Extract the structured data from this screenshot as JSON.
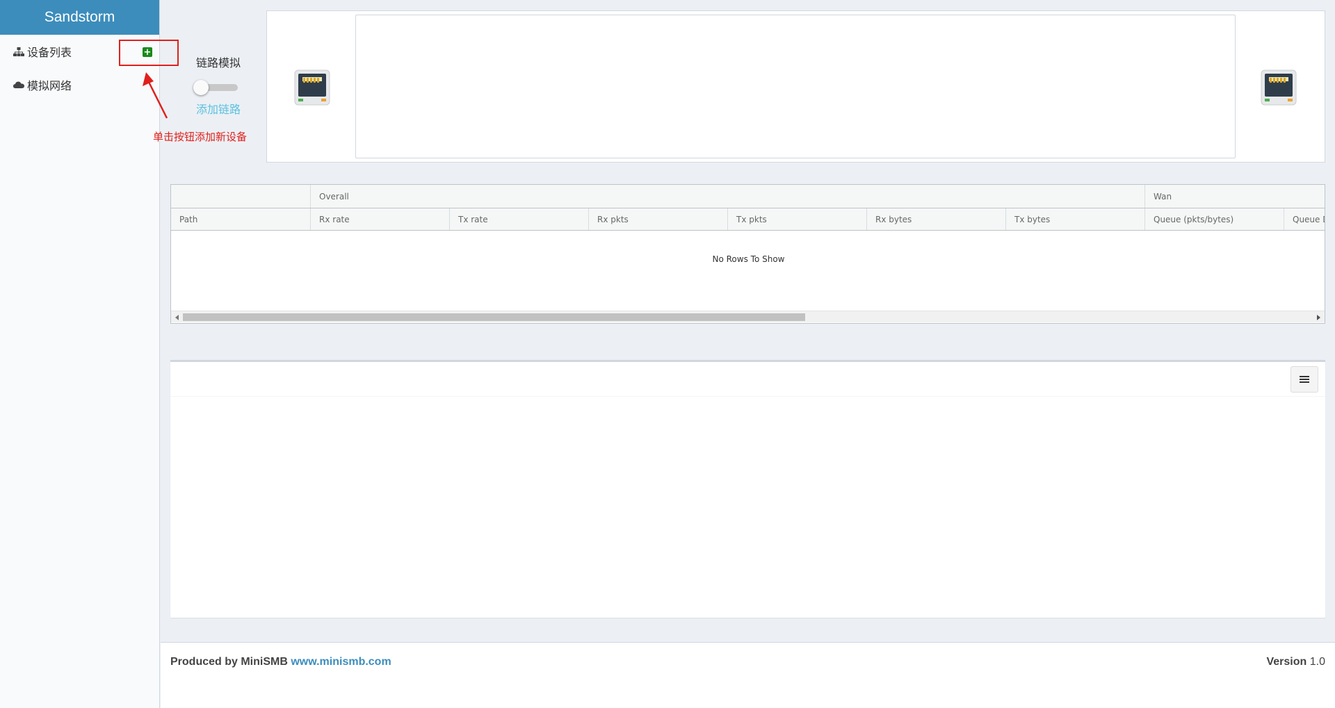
{
  "app": {
    "brand": "Sandstorm",
    "brand_color": "#3c8dbc"
  },
  "sidebar": {
    "items": [
      {
        "label": "设备列表",
        "icon": "sitemap-icon"
      },
      {
        "label": "模拟网络",
        "icon": "cloud-icon"
      }
    ],
    "add_button_icon": "plus-square-icon"
  },
  "annotation": {
    "text": "单击按钮添加新设备",
    "color": "#e0201c"
  },
  "link_sim": {
    "title": "链路模拟",
    "toggle_on": false,
    "add_link_label": "添加链路"
  },
  "top_panel": {
    "left_icon": "ethernet-port-icon",
    "right_icon": "ethernet-port-icon"
  },
  "table": {
    "group_headers": [
      "",
      "Overall",
      "Wan"
    ],
    "columns": [
      "Path",
      "Rx rate",
      "Tx rate",
      "Rx pkts",
      "Tx pkts",
      "Rx bytes",
      "Tx bytes",
      "Queue (pkts/bytes)",
      "Queue D"
    ],
    "rows": [],
    "empty_message": "No Rows To Show"
  },
  "bottom_panel": {
    "menu_icon": "hamburger-menu-icon"
  },
  "footer": {
    "produced_by": "Produced by MiniSMB",
    "link_text": "www.minismb.com",
    "version_label": "Version",
    "version_value": "1.0"
  }
}
